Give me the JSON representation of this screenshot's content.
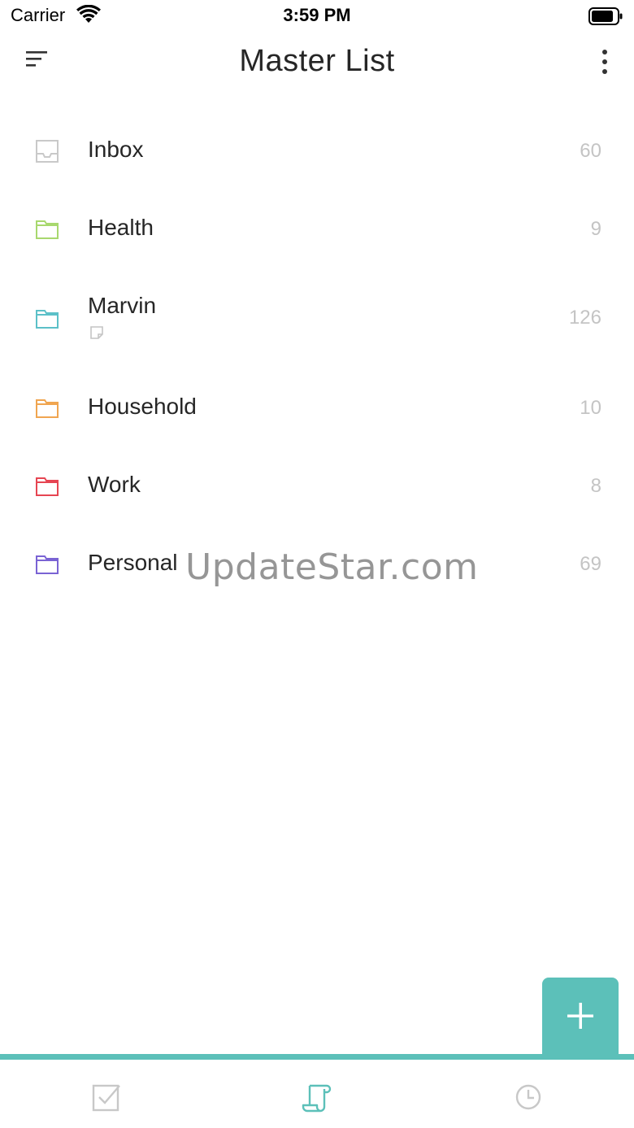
{
  "status_bar": {
    "carrier": "Carrier",
    "time": "3:59 PM"
  },
  "header": {
    "title": "Master List",
    "sort_icon": "sort-lines-icon",
    "more_icon": "more-vertical-icon"
  },
  "lists": [
    {
      "label": "Inbox",
      "count": "60",
      "icon": "inbox-tray-icon",
      "color": "#c9c9c9"
    },
    {
      "label": "Health",
      "count": "9",
      "icon": "folder-icon",
      "color": "#a8d86e"
    },
    {
      "label": "Marvin",
      "count": "126",
      "icon": "folder-icon",
      "color": "#5cc0c8",
      "sub_icon": "note-icon"
    },
    {
      "label": "Household",
      "count": "10",
      "icon": "folder-icon",
      "color": "#f0a550"
    },
    {
      "label": "Work",
      "count": "8",
      "icon": "folder-icon",
      "color": "#e64552"
    },
    {
      "label": "Personal",
      "count": "69",
      "icon": "folder-icon",
      "color": "#7a63d4"
    }
  ],
  "watermark": "UpdateStar.com",
  "fab": {
    "icon": "plus-icon",
    "color": "#5cc0b9"
  },
  "tabs": [
    {
      "icon": "checkbox-icon",
      "active": false
    },
    {
      "icon": "scroll-list-icon",
      "active": true
    },
    {
      "icon": "clock-icon",
      "active": false
    }
  ],
  "colors": {
    "accent": "#5cc0b9",
    "count": "#c4c4c4",
    "inactive_tab": "#c8c8c8"
  }
}
